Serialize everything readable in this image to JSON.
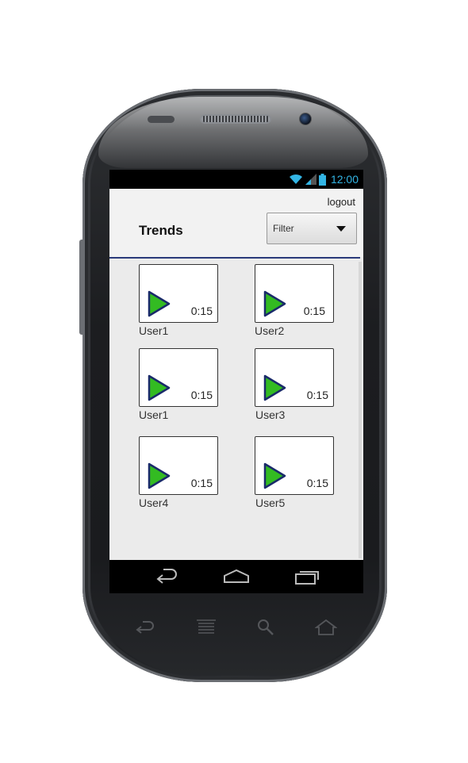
{
  "status": {
    "time": "12:00"
  },
  "header": {
    "logout_label": "logout",
    "title": "Trends",
    "filter_label": "Filter"
  },
  "videos": [
    {
      "duration": "0:15",
      "user": "User1"
    },
    {
      "duration": "0:15",
      "user": "User2"
    },
    {
      "duration": "0:15",
      "user": "User1"
    },
    {
      "duration": "0:15",
      "user": "User3"
    },
    {
      "duration": "0:15",
      "user": "User4"
    },
    {
      "duration": "0:15",
      "user": "User5"
    }
  ],
  "colors": {
    "play_fill": "#33bb22",
    "play_stroke": "#1a2a6a",
    "status_accent": "#33b5e5",
    "divider": "#2a3a7a"
  },
  "icons": [
    "wifi-icon",
    "signal-icon",
    "battery-icon",
    "play-icon",
    "back-icon",
    "home-icon",
    "recents-icon",
    "chevron-down-icon"
  ]
}
